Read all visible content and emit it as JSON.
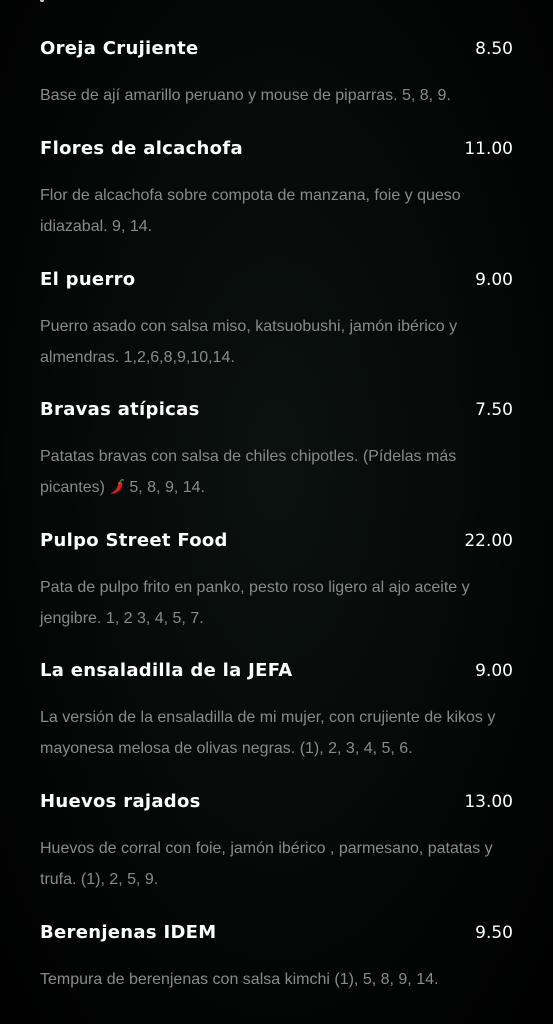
{
  "menu": {
    "items": [
      {
        "name": "Oreja Crujiente",
        "price": "8.50",
        "description": "Base de ají amarillo peruano y mouse de piparras. 5, 8, 9."
      },
      {
        "name": "Flores de alcachofa",
        "price": "11.00",
        "description": "Flor de alcachofa sobre compota de manzana, foie y queso idiazabal. 9, 14."
      },
      {
        "name": "El puerro",
        "price": "9.00",
        "description": "Puerro asado con salsa miso, katsuobushi, jamón ibérico y almendras. 1,2,6,8,9,10,14."
      },
      {
        "name": "Bravas atípicas",
        "price": "7.50",
        "description_before_icon": "Patatas bravas con salsa de chiles chipotles. (Pídelas más picantes)",
        "icon": "chili-pepper-icon",
        "description_after_icon": "5, 8, 9, 14."
      },
      {
        "name": "Pulpo Street Food",
        "price": "22.00",
        "description": "Pata de pulpo frito en panko, pesto roso ligero al ajo aceite y jengibre. 1, 2 3, 4, 5, 7."
      },
      {
        "name": "La ensaladilla de la JEFA",
        "price": "9.00",
        "description": "La versión de la ensaladilla de mi mujer, con crujiente de kikos y mayonesa melosa de olivas negras. (1), 2, 3, 4, 5, 6."
      },
      {
        "name": "Huevos rajados",
        "price": "13.00",
        "description": "Huevos de corral con foie, jamón ibérico , parmesano, patatas y trufa. (1), 2, 5, 9."
      },
      {
        "name": "Berenjenas IDEM",
        "price": "9.50",
        "description": "Tempura de berenjenas con salsa kimchi (1), 5, 8, 9, 14."
      }
    ]
  },
  "colors": {
    "background": "#000000",
    "name_text": "#ffffff",
    "price_text": "#ffffff",
    "description_text": "#8a8a8a",
    "chili": "#d4241c"
  }
}
